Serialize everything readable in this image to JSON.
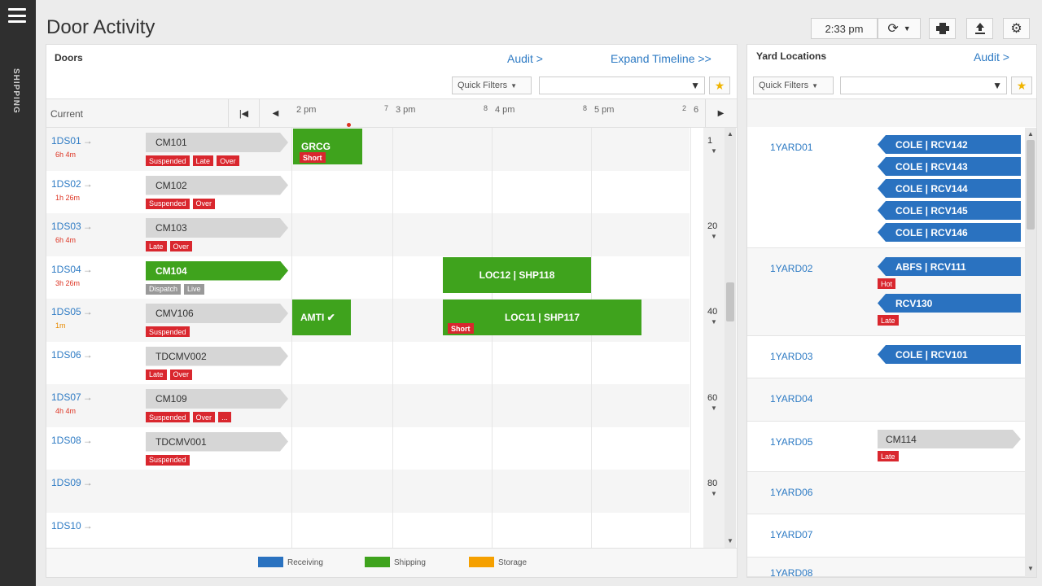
{
  "nav": {
    "label": "SHIPPING"
  },
  "page": {
    "title": "Door Activity"
  },
  "toolbar": {
    "time": "2:33 pm"
  },
  "doors_panel": {
    "header": "Doors",
    "audit": "Audit >",
    "expand": "Expand Timeline >>",
    "quick_filters": "Quick Filters",
    "current_label": "Current",
    "timeline_hours": [
      {
        "label": "2 pm",
        "num": "7"
      },
      {
        "label": "3 pm",
        "num": "8"
      },
      {
        "label": "4 pm",
        "num": "8"
      },
      {
        "label": "5 pm",
        "num": "2"
      },
      {
        "label": "6",
        "num": ""
      }
    ],
    "rows": [
      {
        "door": "1DS01",
        "time": "6h 4m",
        "time_color": "red",
        "chip": "CM101",
        "chip_color": "gray",
        "badges": [
          {
            "t": "Suspended"
          },
          {
            "t": "Late"
          },
          {
            "t": "Over"
          }
        ]
      },
      {
        "door": "1DS02",
        "time": "1h 26m",
        "time_color": "red",
        "chip": "CM102",
        "chip_color": "gray",
        "badges": [
          {
            "t": "Suspended"
          },
          {
            "t": "Over"
          }
        ]
      },
      {
        "door": "1DS03",
        "time": "6h 4m",
        "time_color": "red",
        "chip": "CM103",
        "chip_color": "gray",
        "badges": [
          {
            "t": "Late"
          },
          {
            "t": "Over"
          }
        ]
      },
      {
        "door": "1DS04",
        "time": "3h 26m",
        "time_color": "red",
        "chip": "CM104",
        "chip_color": "green",
        "badges": [
          {
            "t": "Dispatch",
            "gray": true
          },
          {
            "t": "Live",
            "gray": true
          }
        ]
      },
      {
        "door": "1DS05",
        "time": "1m",
        "time_color": "orange",
        "chip": "CMV106",
        "chip_color": "gray",
        "badges": [
          {
            "t": "Suspended"
          }
        ]
      },
      {
        "door": "1DS06",
        "time": "",
        "chip": "TDCMV002",
        "chip_color": "gray",
        "badges": [
          {
            "t": "Late"
          },
          {
            "t": "Over"
          }
        ]
      },
      {
        "door": "1DS07",
        "time": "4h 4m",
        "time_color": "red",
        "chip": "CM109",
        "chip_color": "gray",
        "badges": [
          {
            "t": "Suspended"
          },
          {
            "t": "Over"
          },
          {
            "t": "..."
          }
        ]
      },
      {
        "door": "1DS08",
        "time": "",
        "chip": "TDCMV001",
        "chip_color": "gray",
        "badges": [
          {
            "t": "Suspended"
          }
        ]
      },
      {
        "door": "1DS09",
        "time": "",
        "chip": "",
        "badges": []
      },
      {
        "door": "1DS10",
        "time": "",
        "chip": "",
        "badges": []
      }
    ],
    "timeline_blocks": [
      {
        "label": "GRCG",
        "badge": "Short"
      },
      {
        "label": "LOC12 | SHP118",
        "badge": ""
      },
      {
        "label": "AMTI ✔",
        "badge": ""
      },
      {
        "label": "LOC11 | SHP117",
        "badge": "Short"
      }
    ],
    "scale": [
      "1",
      "20",
      "40",
      "60",
      "80"
    ],
    "legend": [
      {
        "label": "Receiving",
        "color": "#2a72c0"
      },
      {
        "label": "Shipping",
        "color": "#3fa31d"
      },
      {
        "label": "Storage",
        "color": "#f5a000"
      }
    ]
  },
  "yard_panel": {
    "header": "Yard Locations",
    "audit": "Audit >",
    "quick_filters": "Quick Filters",
    "rows": [
      {
        "loc": "1YARD01",
        "items": [
          {
            "label": "COLE | RCV142",
            "color": "blue"
          },
          {
            "label": "COLE | RCV143",
            "color": "blue"
          },
          {
            "label": "COLE | RCV144",
            "color": "blue"
          },
          {
            "label": "COLE | RCV145",
            "color": "blue"
          },
          {
            "label": "COLE | RCV146",
            "color": "blue"
          }
        ]
      },
      {
        "loc": "1YARD02",
        "items": [
          {
            "label": "ABFS | RCV111",
            "color": "blue",
            "badge": "Hot"
          },
          {
            "label": "RCV130",
            "color": "blue",
            "badge": "Late"
          }
        ]
      },
      {
        "loc": "1YARD03",
        "items": [
          {
            "label": "COLE | RCV101",
            "color": "blue"
          }
        ]
      },
      {
        "loc": "1YARD04",
        "items": []
      },
      {
        "loc": "1YARD05",
        "items": [
          {
            "label": "CM114",
            "color": "gray",
            "badge": "Late"
          }
        ]
      },
      {
        "loc": "1YARD06",
        "items": []
      },
      {
        "loc": "1YARD07",
        "items": []
      },
      {
        "loc": "1YARD08",
        "items": []
      }
    ]
  }
}
